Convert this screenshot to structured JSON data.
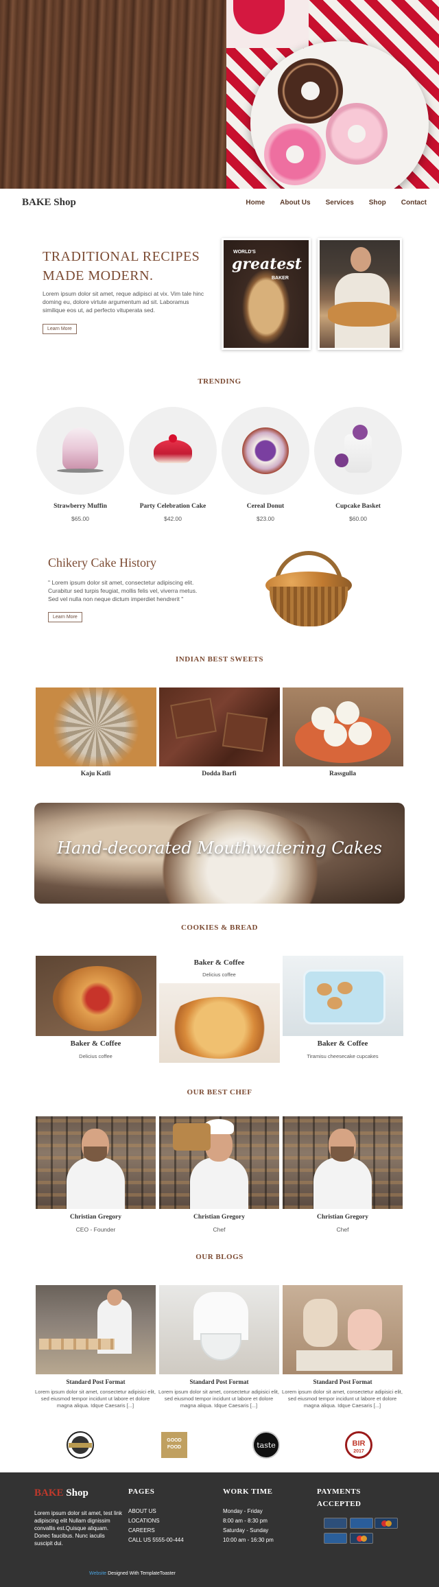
{
  "brand": {
    "name": "BAKE Shop",
    "footer_prefix": "BAKE",
    "footer_suffix": " Shop"
  },
  "nav": [
    "Home",
    "About Us",
    "Services",
    "Shop",
    "Contact"
  ],
  "intro": {
    "title": "TRADITIONAL RECIPES MADE MODERN.",
    "text": "Lorem ipsum dolor sit amet, reque adipisci at vix. Vim tale hinc doming eu, dolore virtute argumentum ad sit. Laboramus similique eos ut, ad perfecto vituperata sed.",
    "button": "Learn More",
    "poster_small": "WORLD'S",
    "poster_big": "greatest",
    "poster_small2": "BAKER"
  },
  "trending": {
    "title": "TRENDING",
    "items": [
      {
        "name": "Strawberry Muffin",
        "price": "$65.00"
      },
      {
        "name": "Party Celebration Cake",
        "price": "$42.00"
      },
      {
        "name": "Cereal Donut",
        "price": "$23.00"
      },
      {
        "name": "Cupcake Basket",
        "price": "$60.00"
      }
    ]
  },
  "history": {
    "title": "Chikery Cake History",
    "text": "\" Lorem ipsum dolor sit amet, consectetur adipiscing elit. Curabitur sed turpis feugiat, mollis felis vel, viverra metus. Sed vel nulla non neque dictum imperdiet hendrerit \"",
    "button": "Learn More"
  },
  "sweets": {
    "title": "INDIAN BEST SWEETS",
    "items": [
      "Kaju Katli",
      "Dodda Barfi",
      "Rassgulla"
    ]
  },
  "banner": {
    "text": "Hand-decorated Mouthwatering Cakes"
  },
  "cookies": {
    "title": "COOKIES & BREAD",
    "items": [
      {
        "name": "Baker & Coffee",
        "sub": "Delicius coffee"
      },
      {
        "name": "Baker & Coffee",
        "sub": "Delicius coffee"
      },
      {
        "name": "Baker & Coffee",
        "sub": "Tiramisu cheesecake cupcakes"
      }
    ]
  },
  "chefs": {
    "title": "OUR BEST CHEF",
    "items": [
      {
        "name": "Christian Gregory",
        "role": "CEO - Founder"
      },
      {
        "name": "Christian Gregory",
        "role": "Chef"
      },
      {
        "name": "Christian Gregory",
        "role": "Chef"
      }
    ]
  },
  "blogs": {
    "title": "OUR BLOGS",
    "items": [
      {
        "title": "Standard Post Format",
        "text": "Lorem ipsum dolor sit amet, consectetur adipisici elit, sed eiusmod tempor incidunt ut labore et dolore magna aliqua. Idque Caesaris [...]"
      },
      {
        "title": "Standard Post Format",
        "text": "Lorem ipsum dolor sit amet, consectetur adipisici elit, sed eiusmod tempor incidunt ut labore et dolore magna aliqua. Idque Caesaris [...]"
      },
      {
        "title": "Standard Post Format",
        "text": "Lorem ipsum dolor sit amet, consectetur adipisici elit, sed eiusmod tempor incidunt ut labore et dolore magna aliqua. Idque Caesaris [...]"
      }
    ]
  },
  "logos": {
    "l2_top": "GOOD",
    "l2_mid": "FOOD",
    "l3": "taste",
    "l4": "BIR",
    "l4_year": "2017"
  },
  "footer": {
    "about": "Lorem ipsum dolor sit amet, test link adipiscing elit Nullam dignissim convallis est.Quisque aliquam. Donec faucibus. Nunc iaculis suscipit dui.",
    "pages_title": "PAGES",
    "pages": [
      "ABOUT US",
      "LOCATIONS",
      "CAREERS",
      "CALL US 5555-00-444"
    ],
    "work_title": "WORK TIME",
    "work": [
      "Monday - Friday",
      "8:00 am - 8:30 pm",
      "Saturday - Sunday",
      "10:00 am - 16:30 pm"
    ],
    "pay_title_1": "PAYMENTS",
    "pay_title_2": "ACCEPTED",
    "credit_link": "Website",
    "credit_text": " Designed With TemplateToaster"
  }
}
